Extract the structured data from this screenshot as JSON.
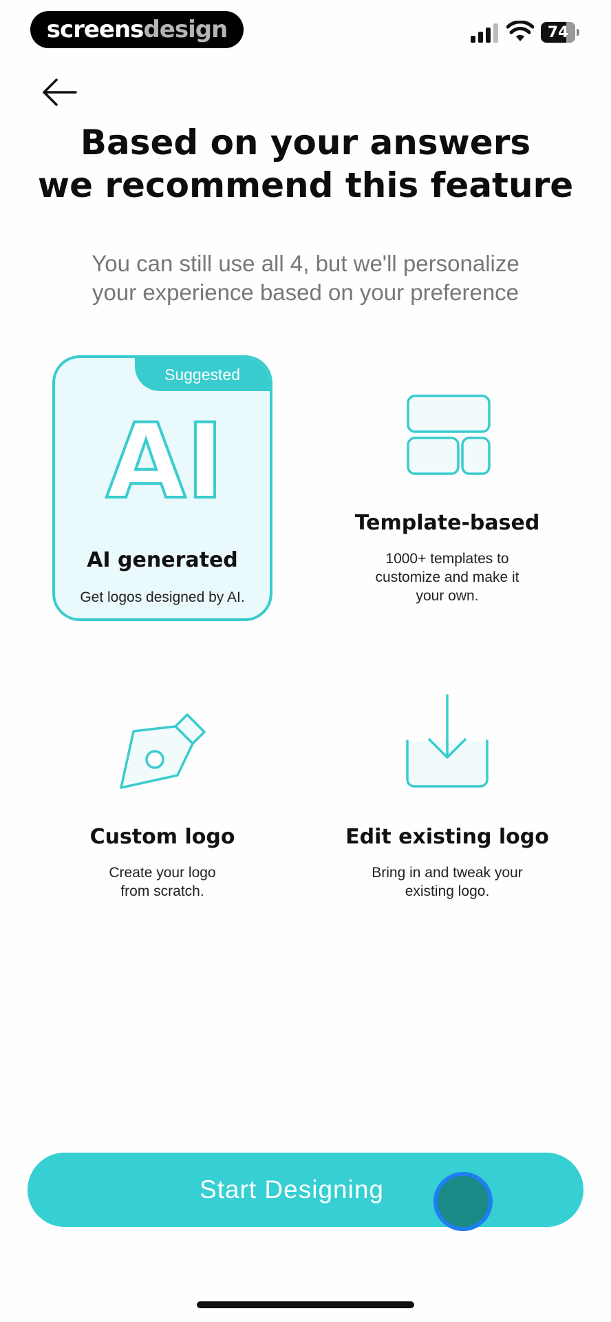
{
  "status_bar": {
    "brand_part1": "screens",
    "brand_part2": "design",
    "battery": "74"
  },
  "header": {
    "title_line1": "Based on your answers",
    "title_line2": "we recommend this feature",
    "subtitle_line1": "You can still use all 4, but we'll personalize",
    "subtitle_line2": "your experience based on your preference"
  },
  "options": {
    "ai": {
      "badge": "Suggested",
      "icon_text": "AI",
      "title": "AI generated",
      "desc": "Get logos designed by AI."
    },
    "template": {
      "title": "Template-based",
      "desc_line1": "1000+ templates to",
      "desc_line2": "customize and make it",
      "desc_line3": "your own."
    },
    "custom": {
      "title": "Custom logo",
      "desc_line1": "Create your logo",
      "desc_line2": "from scratch."
    },
    "edit": {
      "title": "Edit existing logo",
      "desc_line1": "Bring in and tweak your",
      "desc_line2": "existing logo."
    }
  },
  "cta": {
    "label": "Start Designing"
  },
  "colors": {
    "accent": "#36cfd3",
    "card_bg": "#eaf9fb"
  }
}
